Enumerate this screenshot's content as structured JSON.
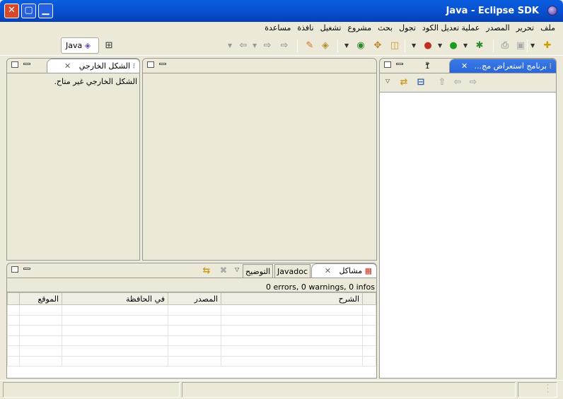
{
  "window": {
    "title": "Java - Eclipse SDK",
    "close": "✕",
    "max": "▢",
    "min": "▁"
  },
  "menu": [
    "ملف",
    "تحرير",
    "المصدر",
    "عملية تعديل الكود",
    "تجول",
    "بحث",
    "مشروع",
    "تشغيل",
    "نافذة",
    "مساعدة"
  ],
  "perspective": {
    "label": "Java"
  },
  "package_explorer": {
    "tab_label": "برنامج استعراض مج...",
    "overflow_count": "1",
    "overflow_chevron": "»",
    "close_icon": "✕"
  },
  "outline": {
    "tab_label": "الشكل الخارجي",
    "message": "الشكل الخارجي غير متاح."
  },
  "bottom": {
    "tabs": {
      "problems": "مشاكل",
      "javadoc": "Javadoc",
      "declaration": "التوضيح"
    },
    "summary": "0 errors, 0 warnings, 0 infos",
    "columns": {
      "description": "الشرح",
      "resource": "المصدر",
      "in_folder": "في الحافظة",
      "location": "الموقع"
    },
    "row_count": 6
  },
  "colors": {
    "accent": "#2a66d8",
    "titlebar": "#0850d0",
    "chrome": "#ece9d8"
  }
}
